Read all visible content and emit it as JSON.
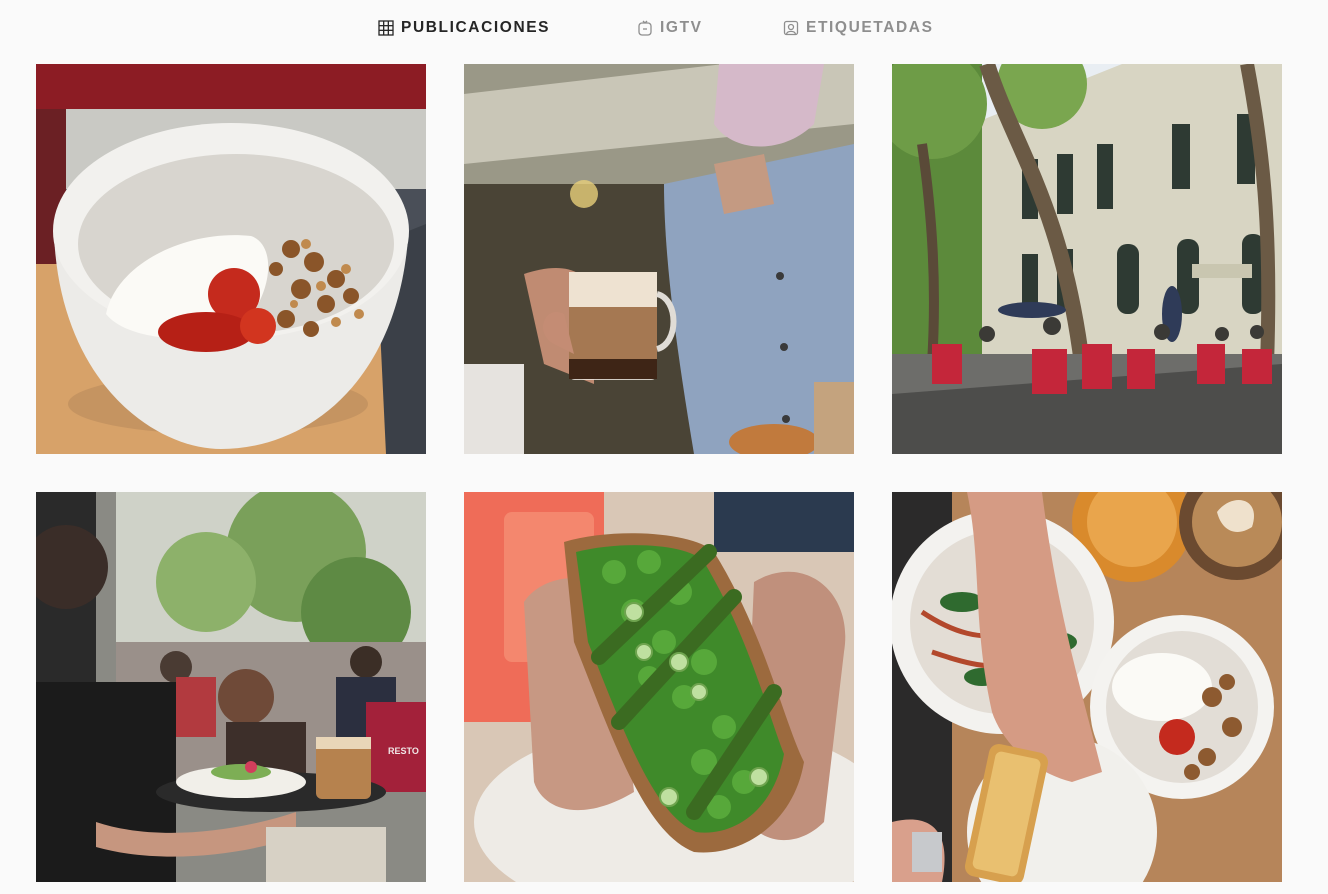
{
  "tabs": [
    {
      "label": "PUBLICACIONES",
      "icon": "grid-icon",
      "active": true
    },
    {
      "label": "IGTV",
      "icon": "igtv-icon",
      "active": false
    },
    {
      "label": "ETIQUETADAS",
      "icon": "tagged-user-icon",
      "active": false
    }
  ],
  "posts": [
    {
      "image": "yogurt-granola-bowl-photo"
    },
    {
      "image": "person-holding-cortado-photo"
    },
    {
      "image": "restaurant-terrace-exterior-photo"
    },
    {
      "image": "waitress-carrying-tray-photo"
    },
    {
      "image": "asparagus-peas-toast-photo"
    },
    {
      "image": "brunch-table-overhead-photo"
    }
  ],
  "post_images": {
    "p4_sign": "RESTO"
  },
  "colors": {
    "active_tab": "#262626",
    "inactive_tab": "#8e8e8e",
    "background": "#fafafa"
  }
}
